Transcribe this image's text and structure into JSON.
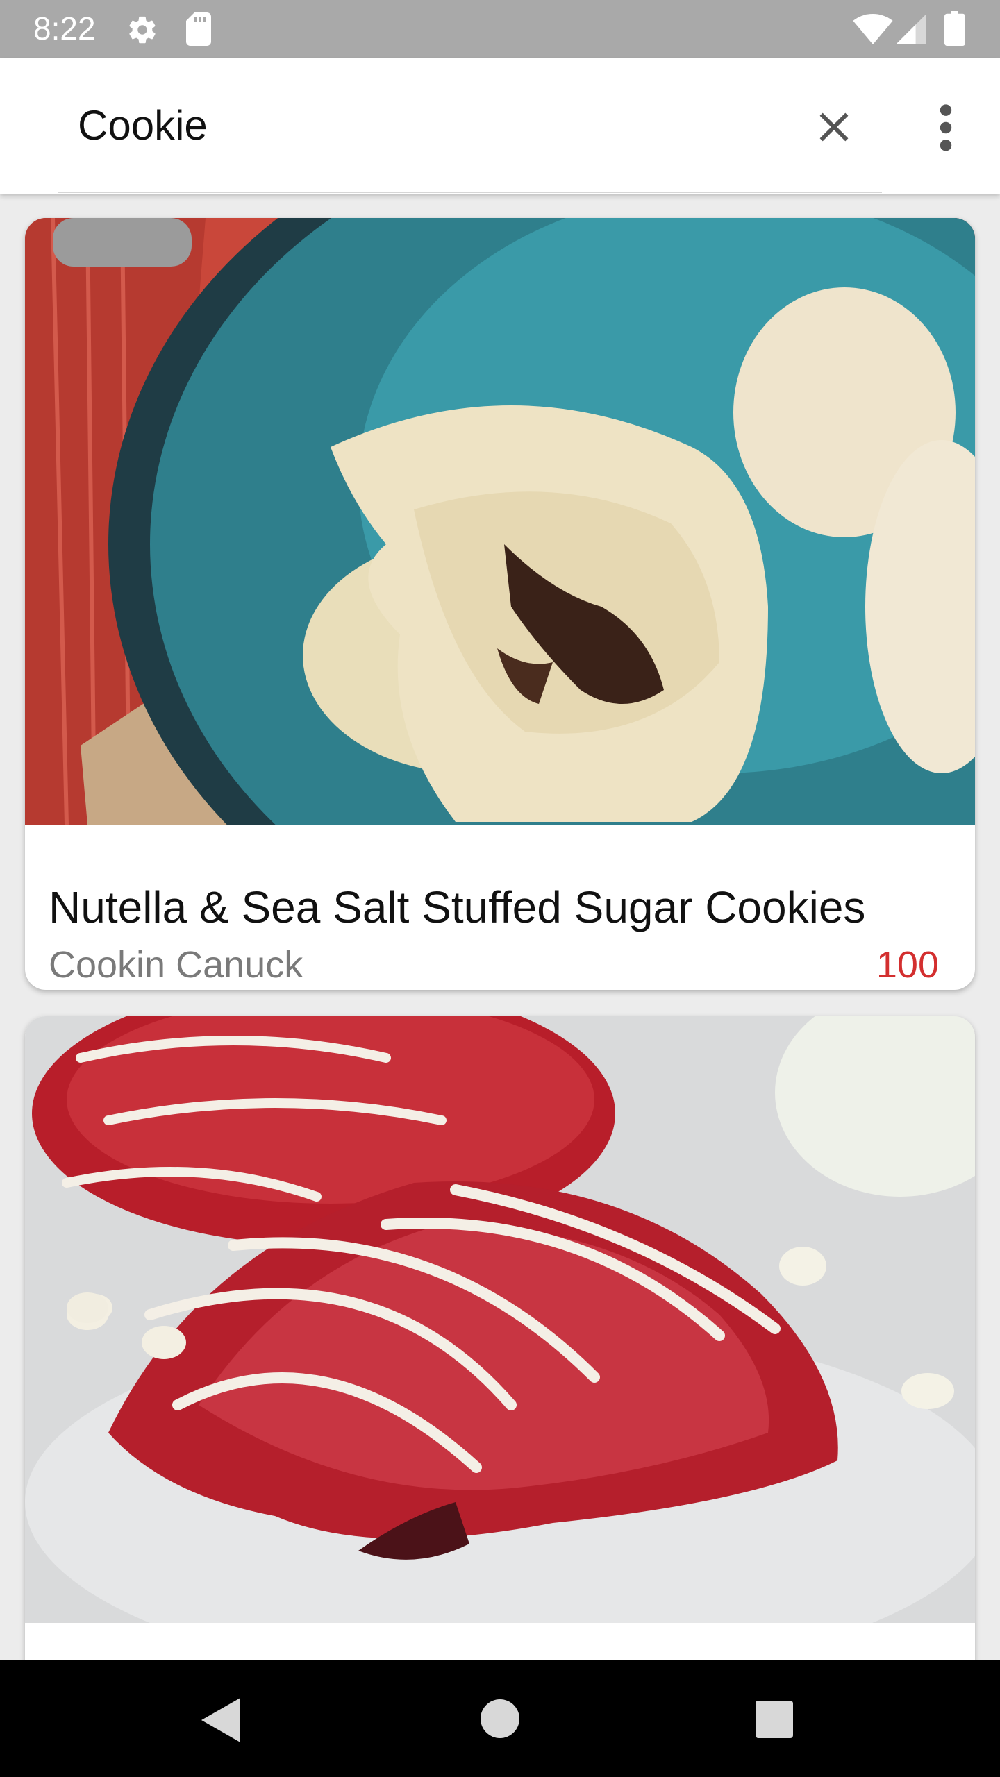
{
  "status_bar": {
    "time": "8:22",
    "icons": [
      "gear-icon",
      "sd-card-icon",
      "wifi-icon",
      "signal-icon",
      "battery-icon"
    ]
  },
  "search": {
    "query": "Cookie",
    "clear_icon": "close-icon",
    "menu_icon": "more-vert-icon"
  },
  "results": [
    {
      "title": "Nutella & Sea Salt Stuffed Sugar Cookies",
      "source": "Cookin Canuck",
      "score": "100",
      "image": "sugar-cookies-on-teal-plate"
    },
    {
      "title": "",
      "source": "",
      "score": "",
      "image": "red-velvet-cookies-with-white-chocolate-drizzle"
    }
  ],
  "nav_bar": {
    "icons": [
      "back-icon",
      "home-icon",
      "recents-icon"
    ]
  },
  "colors": {
    "status_bar": "#a9a9a9",
    "score": "#d32f2f",
    "source_text": "#7a7a7a",
    "background": "#ececec"
  }
}
